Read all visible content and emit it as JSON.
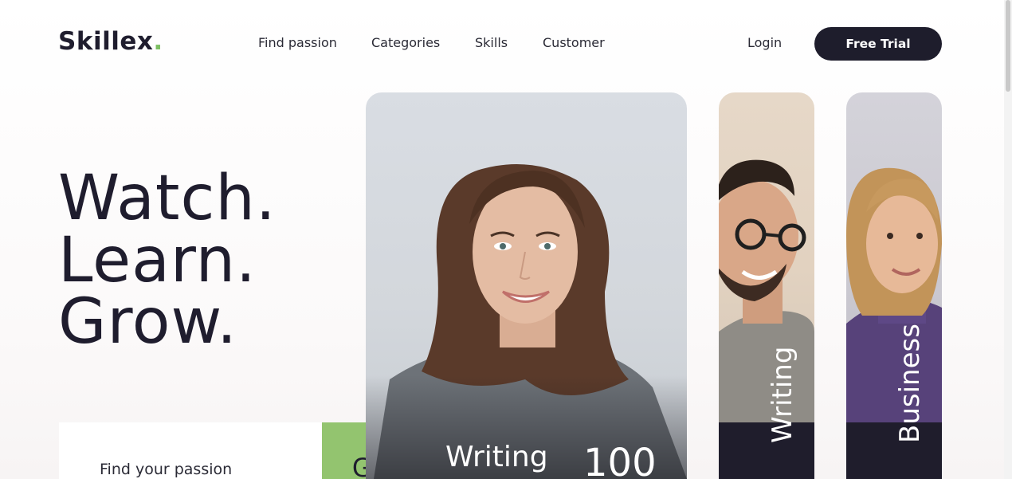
{
  "brand": {
    "name": "Skillex",
    "dot": ".",
    "accent_color": "#7cbf62"
  },
  "nav": {
    "items": [
      {
        "label": "Find passion"
      },
      {
        "label": "Categories"
      },
      {
        "label": "Skills"
      },
      {
        "label": "Customer"
      }
    ],
    "login_label": "Login",
    "trial_label": "Free Trial"
  },
  "hero": {
    "lines": [
      "Watch.",
      "Learn.",
      "Grow."
    ]
  },
  "search": {
    "placeholder": "Find your passion",
    "go_label": "Go",
    "go_color": "#93c46f"
  },
  "cards": {
    "main": {
      "title": "Writing",
      "count": "100"
    },
    "writing": {
      "label": "Writing"
    },
    "business": {
      "label": "Business"
    }
  },
  "colors": {
    "dark": "#1e1d2c"
  }
}
